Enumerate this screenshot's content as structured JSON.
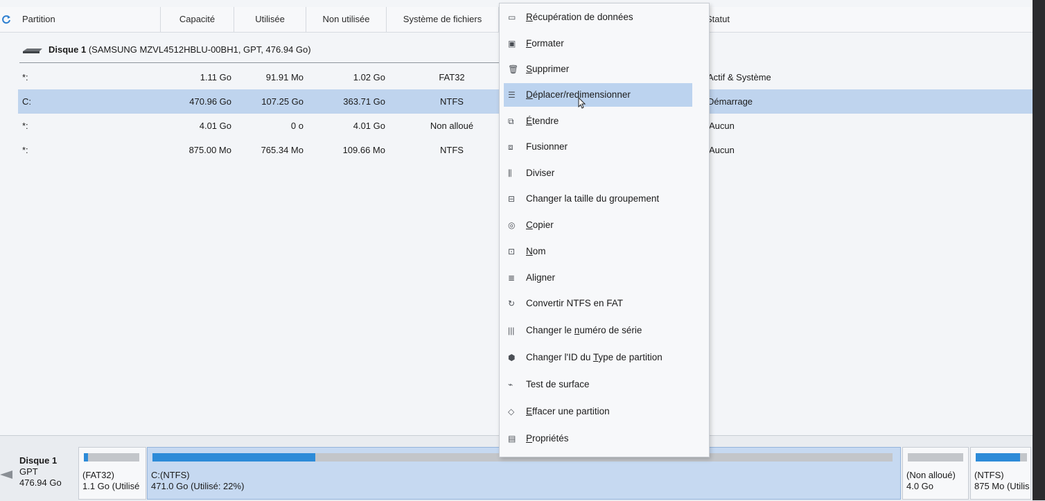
{
  "header": {
    "columns": [
      "Partition",
      "Capacité",
      "Utilisée",
      "Non utilisée",
      "Système de fichiers",
      "Statut"
    ]
  },
  "disk": {
    "title": "Disque 1",
    "details": "(SAMSUNG MZVL4512HBLU-00BH1, GPT, 476.94 Go)"
  },
  "rows": [
    {
      "partition": "*:",
      "capacity": "1.11 Go",
      "used": "91.91 Mo",
      "unused": "1.02 Go",
      "fs": "FAT32",
      "status": "Actif & Système"
    },
    {
      "partition": "C:",
      "capacity": "470.96 Go",
      "used": "107.25 Go",
      "unused": "363.71 Go",
      "fs": "NTFS",
      "status": "Démarrage"
    },
    {
      "partition": "*:",
      "capacity": "4.01 Go",
      "used": "0 o",
      "unused": "4.01 Go",
      "fs": "Non alloué",
      "status": "Aucun"
    },
    {
      "partition": "*:",
      "capacity": "875.00 Mo",
      "used": "765.34 Mo",
      "unused": "109.66 Mo",
      "fs": "NTFS",
      "status": "Aucun"
    }
  ],
  "menu": {
    "items": [
      {
        "pre": "",
        "u": "R",
        "post": "écupération de données",
        "icon": "data-recovery-icon"
      },
      {
        "pre": "",
        "u": "F",
        "post": "ormater",
        "icon": "format-icon"
      },
      {
        "pre": "",
        "u": "S",
        "post": "upprimer",
        "icon": "trash-icon"
      },
      {
        "pre": "",
        "u": "D",
        "post": "éplacer/redimensionner",
        "icon": "resize-sliders-icon"
      },
      {
        "pre": "",
        "u": "É",
        "post": "tendre",
        "icon": "extend-icon"
      },
      {
        "pre": "Fusionner",
        "u": "",
        "post": "",
        "icon": "merge-icon"
      },
      {
        "pre": "Diviser",
        "u": "",
        "post": "",
        "icon": "split-icon"
      },
      {
        "pre": "Changer la taille du groupement",
        "u": "",
        "post": "",
        "icon": "cluster-size-icon"
      },
      {
        "pre": "",
        "u": "C",
        "post": "opier",
        "icon": "copy-icon"
      },
      {
        "pre": "",
        "u": "N",
        "post": "om",
        "icon": "label-icon"
      },
      {
        "pre": "Aligner",
        "u": "",
        "post": "",
        "icon": "align-icon"
      },
      {
        "pre": "Convertir NTFS en FAT",
        "u": "",
        "post": "",
        "icon": "convert-icon"
      },
      {
        "pre": "Changer le ",
        "u": "n",
        "post": "uméro de série",
        "icon": "serial-number-icon"
      },
      {
        "pre": "Changer l'ID du ",
        "u": "T",
        "post": "ype de partition",
        "icon": "partition-type-icon"
      },
      {
        "pre": "Test de surface",
        "u": "",
        "post": "",
        "icon": "surface-test-icon"
      },
      {
        "pre": "",
        "u": "E",
        "post": "ffacer une partition",
        "icon": "eraser-icon"
      },
      {
        "pre": "",
        "u": "P",
        "post": "ropriétés",
        "icon": "properties-icon"
      }
    ],
    "highlighted_index": 3
  },
  "diskmap": {
    "info": [
      "Disque 1",
      "GPT",
      "476.94 Go"
    ],
    "blocks": [
      {
        "line1": "(FAT32)",
        "line2": "1.1 Go (Utilisé",
        "used_fraction": 0.08
      },
      {
        "line1": "C:(NTFS)",
        "line2": "471.0 Go (Utilisé: 22%)",
        "used_fraction": 0.22
      },
      {
        "line1": "(Non alloué)",
        "line2": "4.0 Go",
        "used_fraction": 0.0
      },
      {
        "line1": "(NTFS)",
        "line2": "875 Mo (Utilis",
        "used_fraction": 0.87
      }
    ]
  },
  "colors": {
    "selection": "#bfd4ee",
    "usage_fill": "#2d8bd8",
    "accent": "#1f6fbf"
  }
}
